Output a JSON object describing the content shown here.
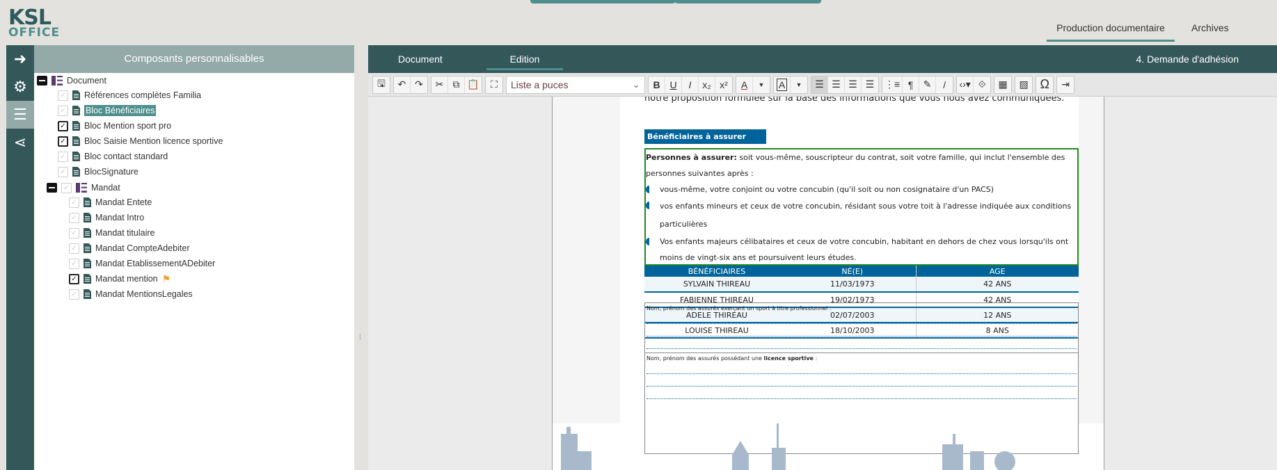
{
  "app": {
    "logo_top": "KSL",
    "logo_bottom": "OFFICE"
  },
  "nav": {
    "items": [
      {
        "label": "Production documentaire",
        "active": true
      },
      {
        "label": "Archives",
        "active": false
      }
    ]
  },
  "left_panel": {
    "title": "Composants personnalisables",
    "tree": {
      "root": "Document",
      "items": [
        {
          "label": "Références complètes Familia",
          "checked": false
        },
        {
          "label": "Bloc Bénéficiaires",
          "checked": false,
          "selected": true
        },
        {
          "label": "Bloc Mention sport pro",
          "checked": true
        },
        {
          "label": "Bloc Saisie Mention licence sportive",
          "checked": true
        },
        {
          "label": "Bloc contact standard",
          "checked": false
        },
        {
          "label": "BlocSignature",
          "checked": false
        }
      ],
      "group": "Mandat",
      "group_items": [
        {
          "label": "Mandat Entete",
          "checked": false
        },
        {
          "label": "Mandat Intro",
          "checked": false
        },
        {
          "label": "Mandat titulaire",
          "checked": false
        },
        {
          "label": "Mandat CompteAdebiter",
          "checked": false
        },
        {
          "label": "Mandat EtablissementADebiter",
          "checked": false
        },
        {
          "label": "Mandat mention",
          "checked": true,
          "flag": true
        },
        {
          "label": "Mandat MentionsLegales",
          "checked": false
        }
      ]
    }
  },
  "editor": {
    "tabs": [
      {
        "label": "Document"
      },
      {
        "label": "Edition",
        "active": true
      }
    ],
    "doc_title": "4. Demande d'adhésion",
    "style_select": "Liste a puces"
  },
  "document": {
    "intro": "notre proposition formulée sur la base des informations que vous nous avez communiquées.",
    "heading": "Bénéficiaires à assurer",
    "lead_bold": "Personnes à assurer:",
    "lead": " soit vous-même, souscripteur du contrat, soit votre famille, qui inclut l'ensemble des personnes suivantes après :",
    "bullets": [
      "vous-même, votre conjoint ou votre concubin (qu'il soit ou non cosignataire d'un PACS)",
      "vos enfants mineurs et ceux de votre concubin, résidant sous votre toit à l'adresse indiquée aux conditions particulières",
      "Vos enfants majeurs célibataires et ceux de votre concubin, habitant en dehors de chez vous lorsqu'ils ont moins de vingt-six ans et poursuivent leurs études."
    ],
    "table": {
      "headers": [
        "BÉNÉFICIAIRES",
        "NÉ(E)",
        "AGE"
      ],
      "rows": [
        [
          "SYLVAIN THIREAU",
          "11/03/1973",
          "42 ANS"
        ],
        [
          "FABIENNE THIREAU",
          "19/02/1973",
          "42 ANS"
        ],
        [
          "ADELE THIREAU",
          "02/07/2003",
          "12 ANS"
        ],
        [
          "LOUISE THIREAU",
          "18/10/2003",
          "8 ANS"
        ]
      ]
    },
    "sport_label": "Nom, prénom des assurés exerçant un sport à titre professionnel :",
    "licence_label": "Nom, prénom des assurés possédant une ",
    "licence_bold": "licence sportive",
    "licence_end": " :"
  }
}
